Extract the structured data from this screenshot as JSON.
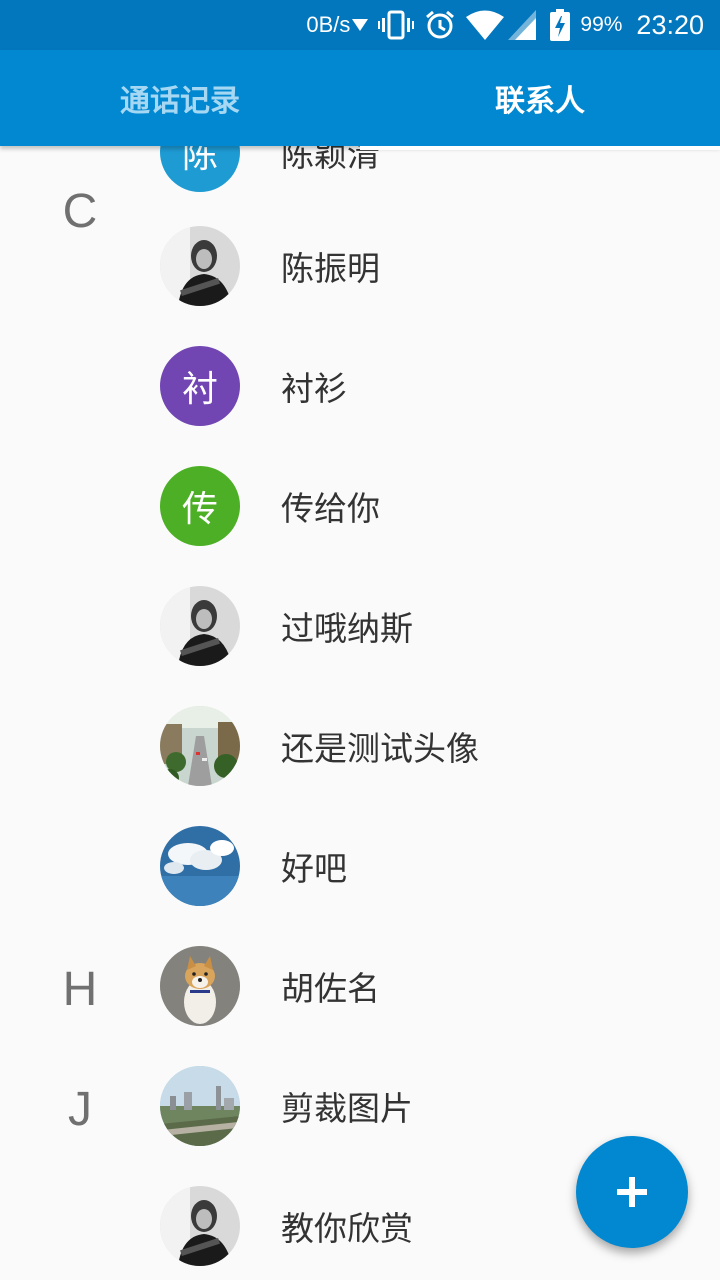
{
  "status_bar": {
    "net_speed": "0B/s",
    "battery": "99%",
    "time": "23:20",
    "icons": [
      "download-arrow-icon",
      "vibrate-icon",
      "alarm-icon",
      "wifi-icon",
      "signal-icon",
      "battery-charging-icon"
    ]
  },
  "tabs": [
    {
      "label": "通话记录",
      "active": false
    },
    {
      "label": "联系人",
      "active": true
    }
  ],
  "contacts": [
    {
      "section": "",
      "name": "陈颖清",
      "avatar": {
        "type": "letter",
        "text": "陈",
        "color": "#1e9bd3"
      }
    },
    {
      "section": "C",
      "name": "陈振明",
      "avatar": {
        "type": "photo",
        "kind": "portrait-guitar"
      }
    },
    {
      "section": "",
      "name": "衬衫",
      "avatar": {
        "type": "letter",
        "text": "衬",
        "color": "#7146b3"
      }
    },
    {
      "section": "",
      "name": "传给你",
      "avatar": {
        "type": "letter",
        "text": "传",
        "color": "#4caf25"
      }
    },
    {
      "section": "",
      "name": "过哦纳斯",
      "avatar": {
        "type": "photo",
        "kind": "portrait-guitar"
      }
    },
    {
      "section": "",
      "name": "还是测试头像",
      "avatar": {
        "type": "photo",
        "kind": "city-street"
      }
    },
    {
      "section": "",
      "name": "好吧",
      "avatar": {
        "type": "photo",
        "kind": "sky-clouds"
      }
    },
    {
      "section": "H",
      "name": "胡佐名",
      "avatar": {
        "type": "photo",
        "kind": "shiba-dog"
      }
    },
    {
      "section": "J",
      "name": "剪裁图片",
      "avatar": {
        "type": "photo",
        "kind": "city-skyline"
      }
    },
    {
      "section": "",
      "name": "教你欣赏",
      "avatar": {
        "type": "photo",
        "kind": "portrait-guitar"
      }
    }
  ],
  "fab": {
    "icon": "plus-icon",
    "color": "#0288d1"
  },
  "colors": {
    "status_bar": "#0277bd",
    "app_bar": "#0288d1",
    "background": "#fafafa"
  }
}
